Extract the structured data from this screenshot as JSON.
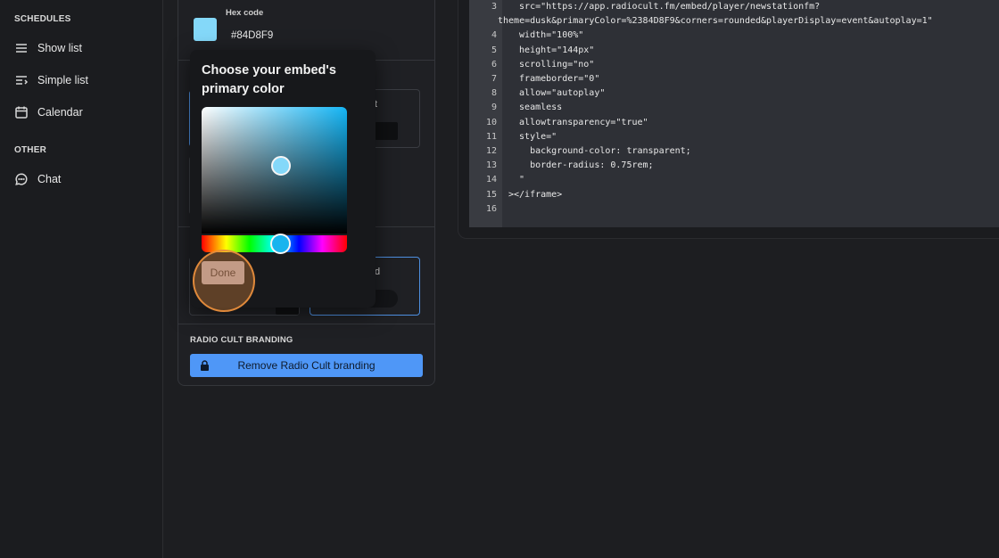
{
  "sidebar": {
    "schedules_title": "SCHEDULES",
    "schedules_items": [
      {
        "label": "Show list",
        "icon": "list-icon"
      },
      {
        "label": "Simple list",
        "icon": "simple-list-icon"
      },
      {
        "label": "Calendar",
        "icon": "calendar-icon"
      }
    ],
    "other_title": "OTHER",
    "other_items": [
      {
        "label": "Chat",
        "icon": "chat-icon"
      }
    ]
  },
  "settings": {
    "hex_label": "Hex code",
    "hex_value": "#84D8F9",
    "option_partial_1": "t",
    "option_partial_2": "d",
    "branding_title": "RADIO CULT BRANDING",
    "branding_button": "Remove Radio Cult branding"
  },
  "picker": {
    "title": "Choose your embed's primary color",
    "done_label": "Done"
  },
  "code": {
    "lines": [
      {
        "n": "3",
        "t": "  src=\"https://app.radiocult.fm/embed/player/newstationfm?"
      },
      {
        "n": "",
        "t": "theme=dusk&primaryColor=%2384D8F9&corners=rounded&playerDisplay=event&autoplay=1\""
      },
      {
        "n": "4",
        "t": "  width=\"100%\""
      },
      {
        "n": "5",
        "t": "  height=\"144px\""
      },
      {
        "n": "6",
        "t": "  scrolling=\"no\""
      },
      {
        "n": "7",
        "t": "  frameborder=\"0\""
      },
      {
        "n": "8",
        "t": "  allow=\"autoplay\""
      },
      {
        "n": "9",
        "t": "  seamless"
      },
      {
        "n": "10",
        "t": "  allowtransparency=\"true\""
      },
      {
        "n": "11",
        "t": "  style=\""
      },
      {
        "n": "12",
        "t": "    background-color: transparent;"
      },
      {
        "n": "13",
        "t": "    border-radius: 0.75rem;"
      },
      {
        "n": "14",
        "t": "  \""
      },
      {
        "n": "15",
        "t": "></iframe>"
      },
      {
        "n": "16",
        "t": ""
      }
    ]
  },
  "colors": {
    "primary": "#84D8F9",
    "accent_button": "#4F97F7",
    "click_highlight": "#E88E3C"
  }
}
